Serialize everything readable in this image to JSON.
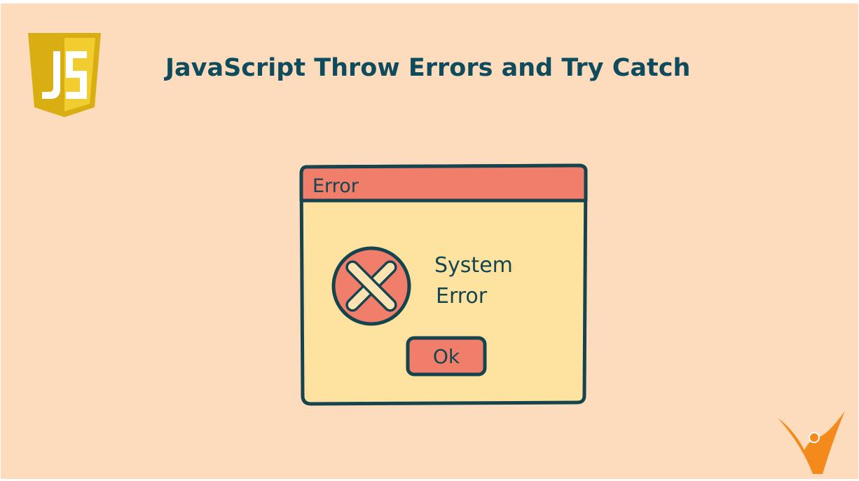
{
  "title": "JavaScript Throw Errors and Try Catch",
  "logo": {
    "letters": "JS",
    "colors": {
      "shield_light": "#f2cd2f",
      "shield_dark": "#d9ae13",
      "letters": "#ffffff"
    }
  },
  "dialog": {
    "title_bar_label": "Error",
    "message_line1": "System",
    "message_line2": "Error",
    "ok_label": "Ok",
    "icon": "error-x-icon"
  },
  "brand_mark": {
    "icon": "person-v-logo-icon",
    "color": "#f48a1c"
  },
  "colors": {
    "background": "#fddcbd",
    "title_text": "#0e4b5c",
    "dialog_body": "#fee2a0",
    "dialog_accent": "#f07e6a",
    "outline": "#16444e"
  }
}
